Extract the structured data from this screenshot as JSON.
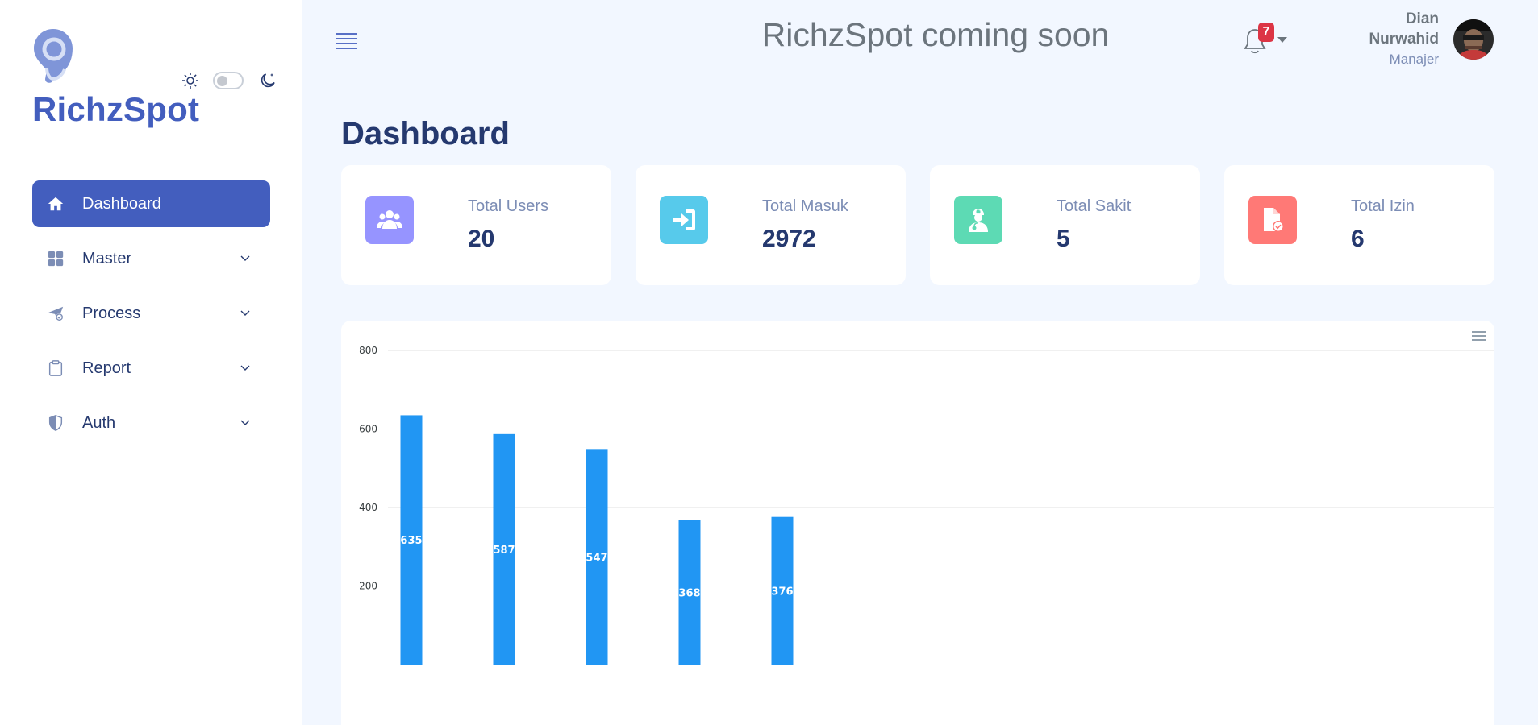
{
  "sidebar": {
    "brand": "RichzSpot",
    "items": [
      {
        "label": "Dashboard",
        "icon": "home-icon",
        "active": true
      },
      {
        "label": "Master",
        "icon": "grid-icon",
        "expandable": true
      },
      {
        "label": "Process",
        "icon": "send-icon",
        "expandable": true
      },
      {
        "label": "Report",
        "icon": "clipboard-icon",
        "expandable": true
      },
      {
        "label": "Auth",
        "icon": "shield-icon",
        "expandable": true
      }
    ]
  },
  "header": {
    "title": "RichzSpot coming soon",
    "notifications": {
      "count": "7",
      "icon": "bell-icon"
    },
    "user": {
      "name_line1": "Dian",
      "name_line2": "Nurwahid",
      "role": "Manajer"
    }
  },
  "main": {
    "page_title": "Dashboard",
    "stats": [
      {
        "label": "Total Users",
        "value": "20",
        "icon": "users-icon",
        "color": "#9694ff"
      },
      {
        "label": "Total Masuk",
        "value": "2972",
        "icon": "sign-in-icon",
        "color": "#57caeb"
      },
      {
        "label": "Total Sakit",
        "value": "5",
        "icon": "medic-icon",
        "color": "#5ddab4"
      },
      {
        "label": "Total Izin",
        "value": "6",
        "icon": "file-check-icon",
        "color": "#ff7976"
      }
    ]
  },
  "chart_data": {
    "type": "bar",
    "values": [
      635,
      587,
      547,
      368,
      376
    ],
    "data_labels": [
      "635",
      "587",
      "547",
      "368",
      "376"
    ],
    "ylim": [
      0,
      800
    ],
    "y_ticks": [
      "800",
      "600",
      "400",
      "200"
    ],
    "grid": true,
    "bar_color": "#2196f3"
  },
  "colors": {
    "accent": "#435ebe",
    "background": "#f2f7ff",
    "badge": "#dc3545"
  }
}
